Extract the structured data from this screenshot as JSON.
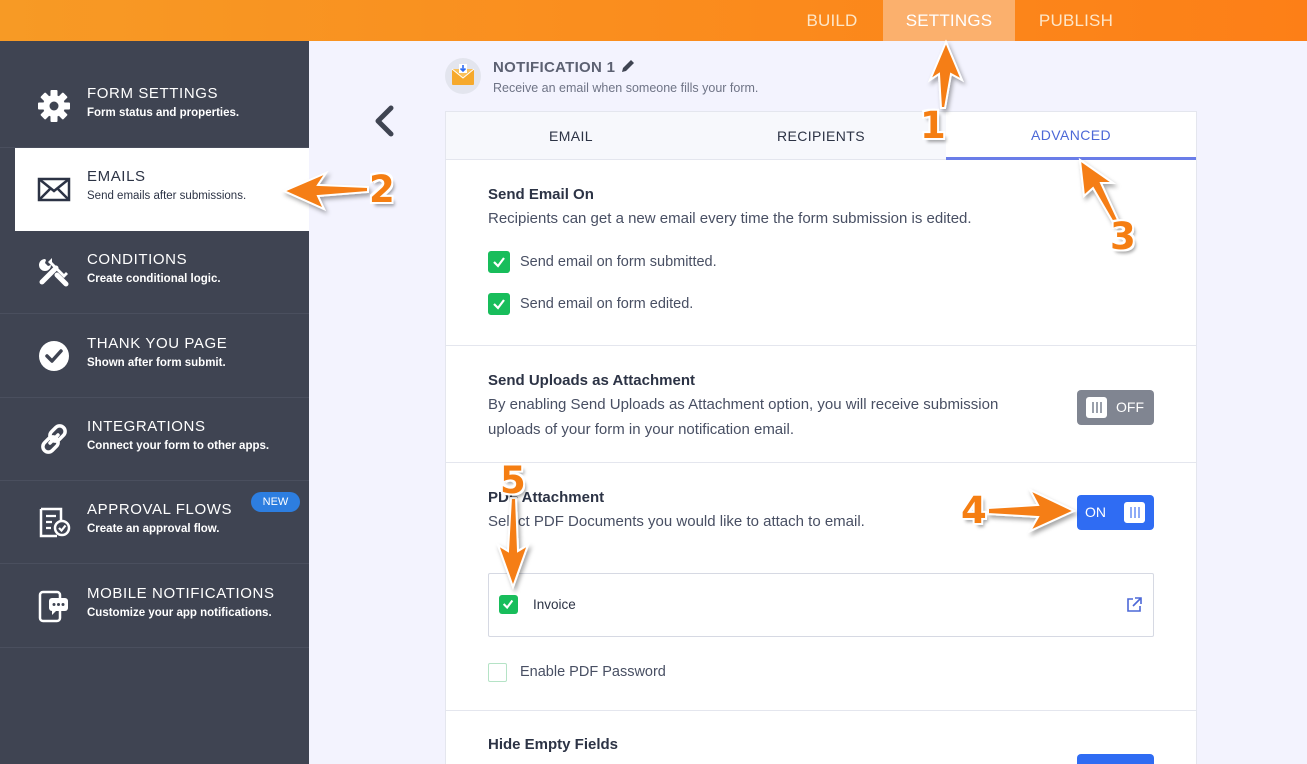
{
  "topbar": {
    "tabs": [
      "BUILD",
      "SETTINGS",
      "PUBLISH"
    ],
    "active_tab": "SETTINGS",
    "color": "#fb8a1c"
  },
  "sidebar": {
    "items": [
      {
        "title": "FORM SETTINGS",
        "subtitle": "Form status and properties.",
        "icon": "gear-icon"
      },
      {
        "title": "EMAILS",
        "subtitle": "Send emails after submissions.",
        "icon": "envelope-icon"
      },
      {
        "title": "CONDITIONS",
        "subtitle": "Create conditional logic.",
        "icon": "tools-icon"
      },
      {
        "title": "THANK YOU PAGE",
        "subtitle": "Shown after form submit.",
        "icon": "check-circle-icon"
      },
      {
        "title": "INTEGRATIONS",
        "subtitle": "Connect your form to other apps.",
        "icon": "link-icon"
      },
      {
        "title": "APPROVAL FLOWS",
        "subtitle": "Create an approval flow.",
        "icon": "approval-icon"
      },
      {
        "title": "MOBILE NOTIFICATIONS",
        "subtitle": "Customize your app notifications.",
        "icon": "mobile-chat-icon"
      }
    ],
    "active_item": "EMAILS",
    "new_badge": "NEW"
  },
  "notification": {
    "title": "NOTIFICATION 1",
    "subtitle": "Receive an email when someone fills your form."
  },
  "tabs": {
    "items": [
      "EMAIL",
      "RECIPIENTS",
      "ADVANCED"
    ],
    "active": "ADVANCED",
    "accent": "#4c68d7"
  },
  "send_email_on": {
    "title": "Send Email On",
    "description": "Recipients can get a new email every time the form submission is edited.",
    "options": [
      {
        "label": "Send email on form submitted.",
        "checked": true
      },
      {
        "label": "Send email on form edited.",
        "checked": true
      }
    ]
  },
  "send_uploads": {
    "title": "Send Uploads as Attachment",
    "description_line1": "By enabling Send Uploads as Attachment option, you will receive submission",
    "description_line2": "uploads of your form in your notification email.",
    "toggle": "OFF"
  },
  "pdf_attachment": {
    "title": "PDF Attachment",
    "description": "Select PDF Documents you would like to attach to email.",
    "toggle": "ON",
    "documents": [
      {
        "label": "Invoice",
        "checked": true
      }
    ],
    "password_option": {
      "label": "Enable PDF Password",
      "checked": false
    }
  },
  "hide_empty": {
    "title": "Hide Empty Fields"
  },
  "annotations": [
    "1",
    "2",
    "3",
    "4",
    "5"
  ],
  "colors": {
    "annotation": "#f57e12",
    "sidebar_bg": "#3f4452",
    "checkbox_green": "#18bd5b",
    "toggle_on": "#2f6cf3",
    "toggle_off": "#808591"
  }
}
